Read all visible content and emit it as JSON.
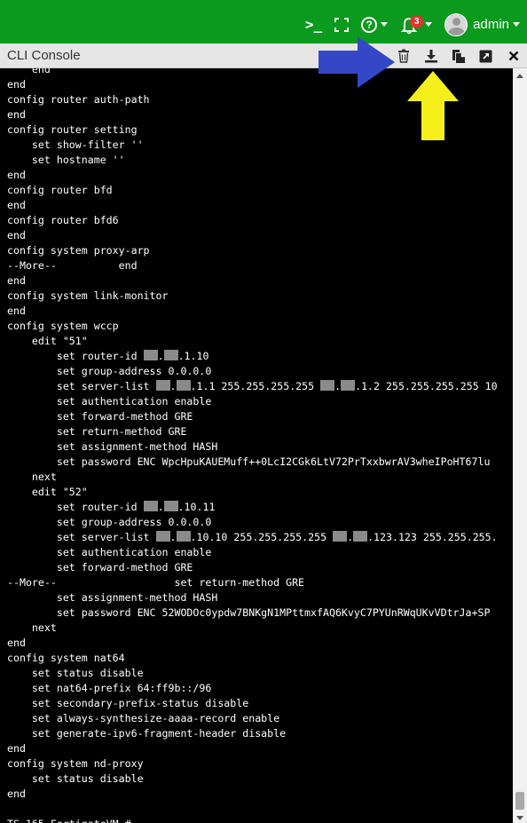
{
  "topbar": {
    "cli_icon": "terminal-icon",
    "fullscreen_icon": "fullscreen-icon",
    "help_icon": "help-icon",
    "help_symbol": "?",
    "bell_icon": "bell-icon",
    "notification_count": "3",
    "user_label": "admin",
    "accent_color": "#0a9a1e",
    "badge_color": "#e0342b"
  },
  "console": {
    "title": "CLI Console",
    "actions": [
      {
        "icon": "trash-icon"
      },
      {
        "icon": "download-icon"
      },
      {
        "icon": "copy-icon"
      },
      {
        "icon": "popout-icon"
      },
      {
        "icon": "close-icon"
      }
    ],
    "prompt": "TS_165-FortigateVM #",
    "lines": [
      "    end",
      "end",
      "config router auth-path",
      "end",
      "config router setting",
      "    set show-filter ''",
      "    set hostname ''",
      "end",
      "config router bfd",
      "end",
      "config router bfd6",
      "end",
      "config system proxy-arp",
      "--More--          end",
      "end",
      "config system link-monitor",
      "end",
      "config system wccp",
      "    edit \"51\"",
      "        set router-id [R].[R].1.10",
      "        set group-address 0.0.0.0",
      "        set server-list [R].[R].1.1 255.255.255.255 [R].[R].1.2 255.255.255.255 10",
      "        set authentication enable",
      "        set forward-method GRE",
      "        set return-method GRE",
      "        set assignment-method HASH",
      "        set password ENC WpcHpuKAUEMuff++0LcI2CGk6LtV72PrTxxbwrAV3wheIPoHT67lu",
      "    next",
      "    edit \"52\"",
      "        set router-id [R].[R].10.11",
      "        set group-address 0.0.0.0",
      "        set server-list [R].[R].10.10 255.255.255.255 [R].[R].123.123 255.255.255.",
      "        set authentication enable",
      "        set forward-method GRE",
      "--More--                   set return-method GRE",
      "        set assignment-method HASH",
      "        set password ENC 52WODOc0ypdw7BNKgN1MPttmxfAQ6KvyC7PYUnRWqUKvVDtrJa+SP",
      "    next",
      "end",
      "config system nat64",
      "    set status disable",
      "    set nat64-prefix 64:ff9b::/96",
      "    set secondary-prefix-status disable",
      "    set always-synthesize-aaaa-record enable",
      "    set generate-ipv6-fragment-header disable",
      "end",
      "config system nd-proxy",
      "    set status disable",
      "end",
      "",
      "TS_165-FortigateVM #"
    ]
  },
  "annotations": {
    "blue_arrow_color": "#3447c7",
    "yellow_arrow_color": "#f5f01c"
  }
}
